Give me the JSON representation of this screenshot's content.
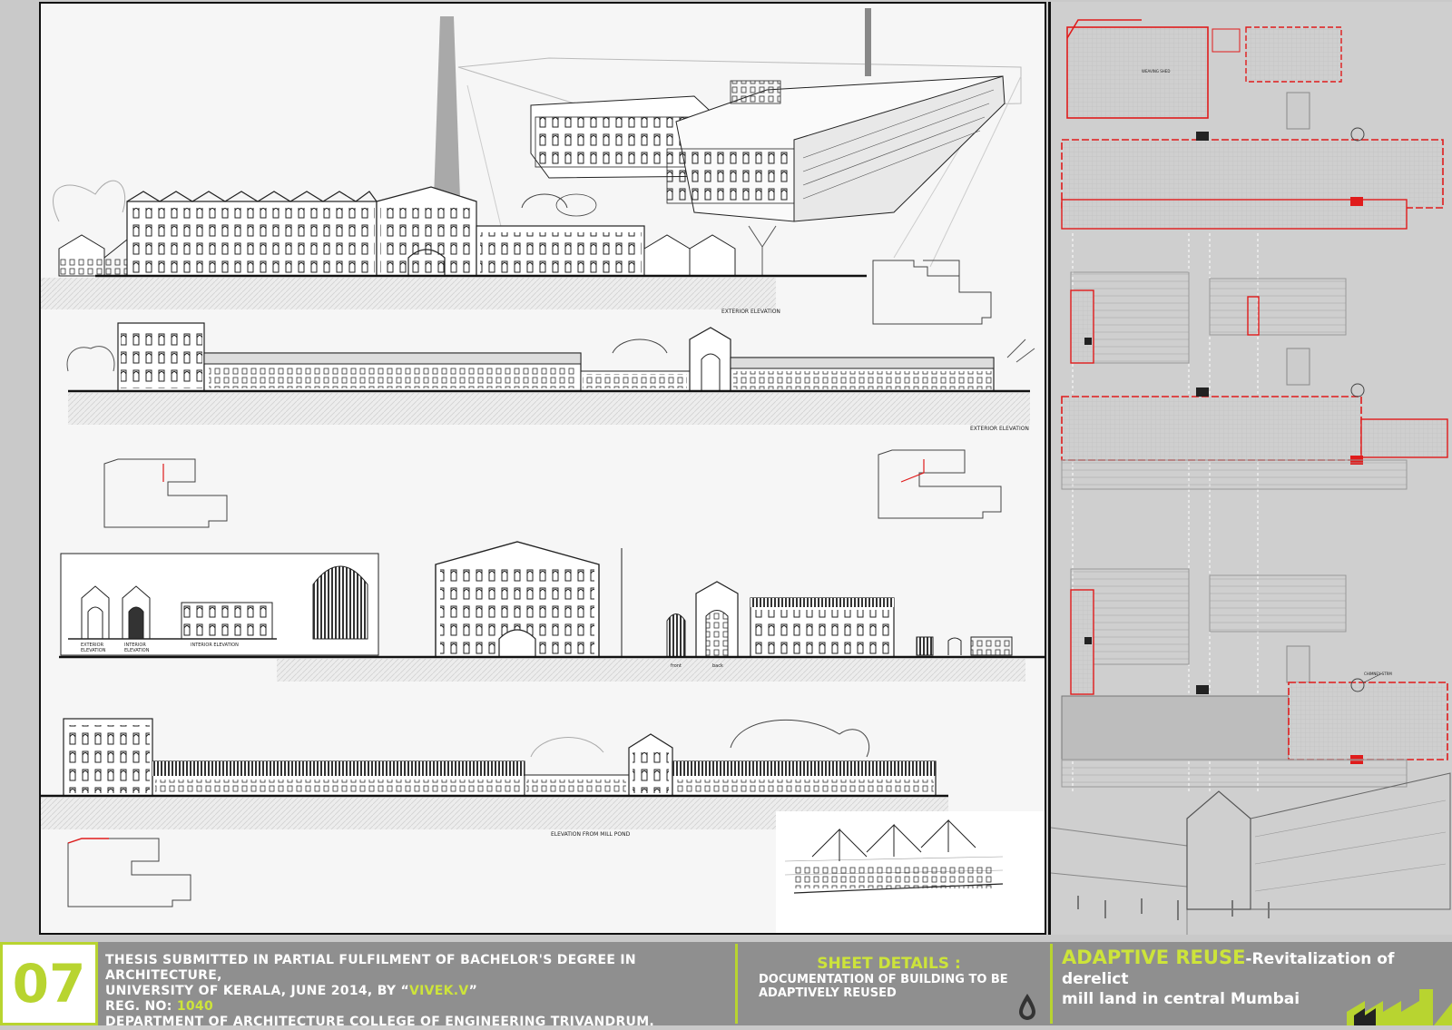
{
  "sheet_number": "07",
  "labels": {
    "exterior_elevation_1": "EXTERIOR ELEVATION",
    "exterior_elevation_2": "EXTERIOR ELEVATION",
    "exterior_elevation_small": "EXTERIOR\nELEVATION",
    "interior_elevation_small": "INTERIOR\nELEVATION",
    "interior_elevation": "INTERIOR ELEVATION",
    "front": "front",
    "back": "back",
    "elevation_mill_pond": "ELEVATION FROM MILL POND",
    "weaving_shed": "WEAVING SHED",
    "chimney": "CHIMNEY STRM"
  },
  "footer": {
    "thesis_line1": "THESIS SUBMITTED IN PARTIAL FULFILMENT OF BACHELOR'S DEGREE IN ARCHITECTURE,",
    "thesis_line2_pre": "UNIVERSITY OF KERALA, JUNE 2014, BY “",
    "author": "VIVEK.V",
    "thesis_line2_post": "”",
    "reg_label": "REG. NO: ",
    "reg_no": "1040",
    "department": "DEPARTMENT OF ARCHITECTURE COLLEGE OF ENGINEERING TRIVANDRUM.",
    "sheet_details_title": "SHEET DETAILS :",
    "sheet_details_line1": "DOCUMENTATION OF BUILDING TO BE",
    "sheet_details_line2": "ADAPTIVELY REUSED",
    "project_title_hl": "ADAPTIVE REUSE",
    "project_title_rest": "-Revitalization of derelict",
    "project_subtitle": "mill land in central Mumbai"
  },
  "colors": {
    "accent": "#b8d430",
    "footer_bg": "#8f8f8f",
    "plan_highlight": "#e01b1b",
    "line": "#222222"
  }
}
